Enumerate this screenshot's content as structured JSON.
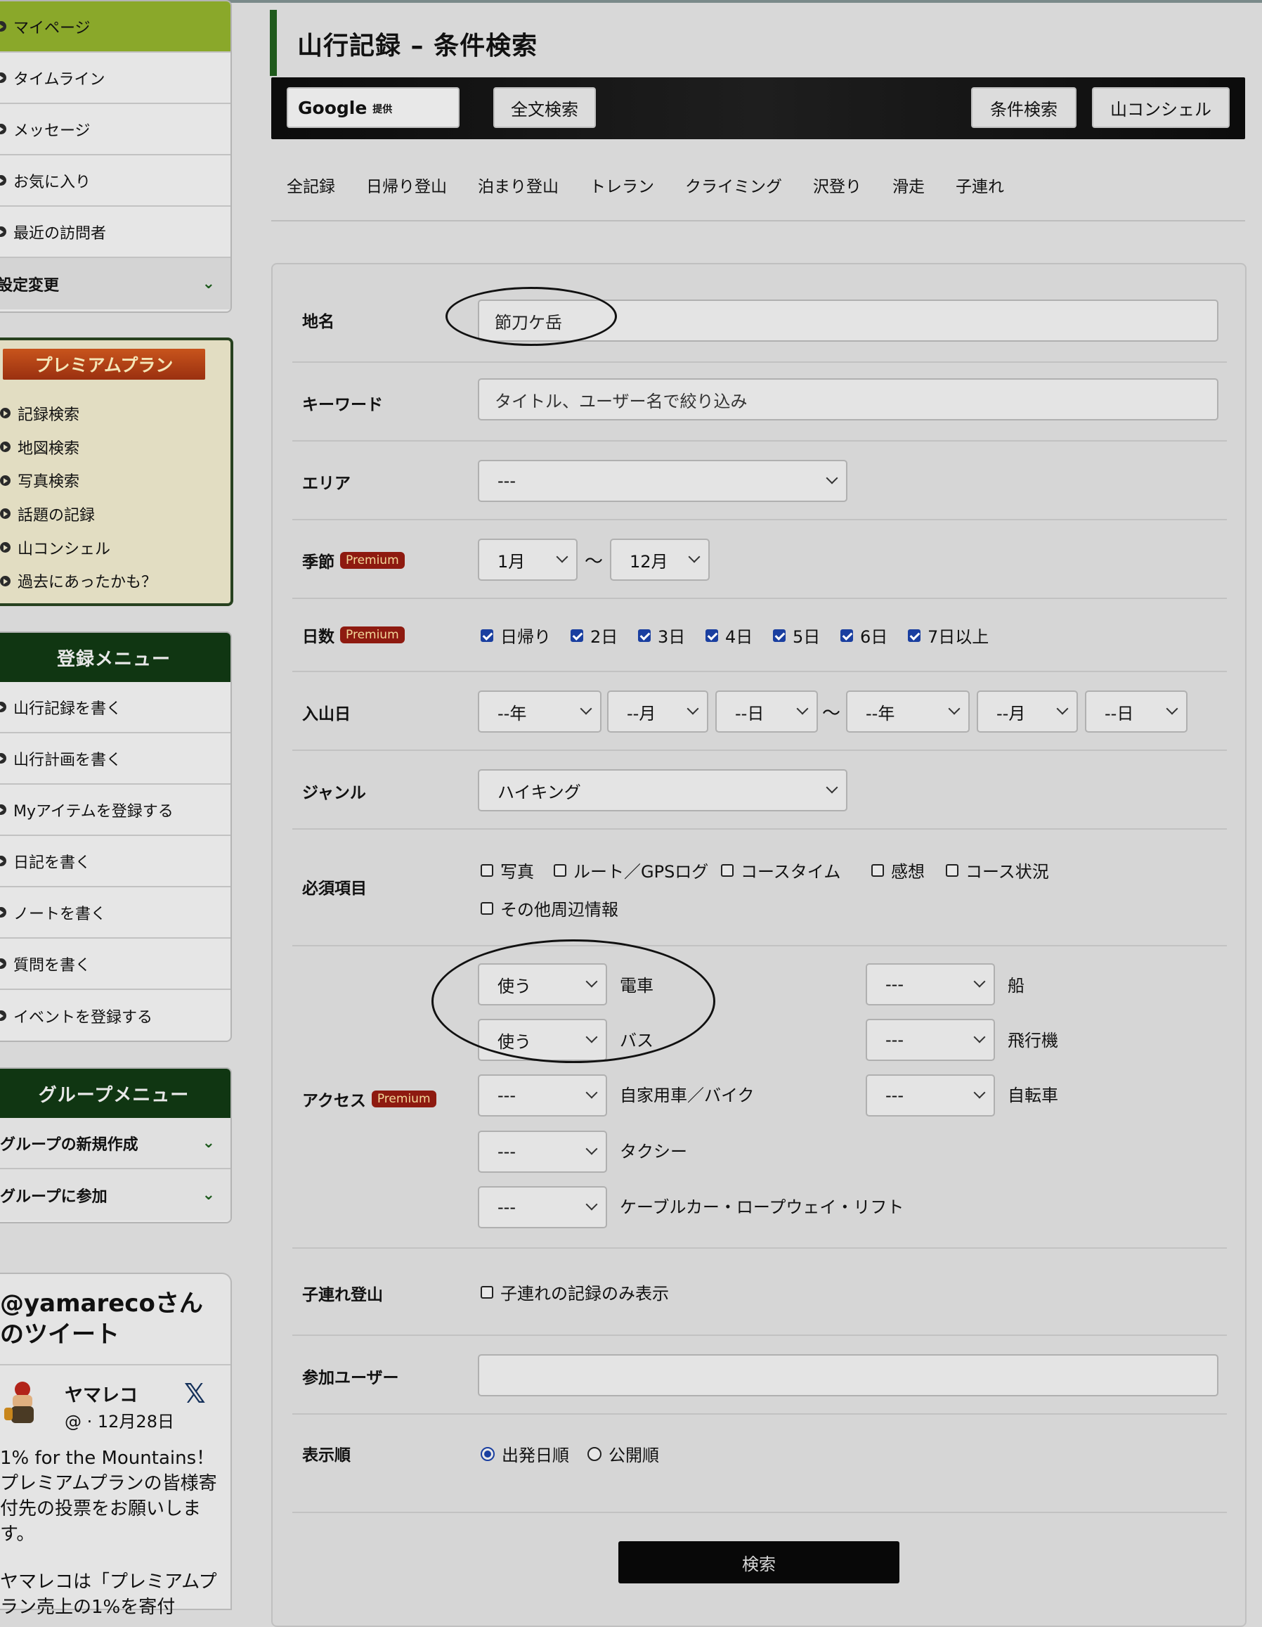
{
  "sidebar": {
    "main_menu": [
      {
        "label": "マイページ",
        "active": true
      },
      {
        "label": "タイムライン"
      },
      {
        "label": "メッセージ"
      },
      {
        "label": "お気に入り"
      },
      {
        "label": "最近の訪問者"
      }
    ],
    "settings_label": "設定変更",
    "premium": {
      "title": "プレミアムプラン",
      "items": [
        "記録検索",
        "地図検索",
        "写真検索",
        "話題の記録",
        "山コンシェル",
        "過去にあったかも？"
      ]
    },
    "register": {
      "title": "登録メニュー",
      "items": [
        "山行記録を書く",
        "山行計画を書く",
        "Myアイテムを登録する",
        "日記を書く",
        "ノートを書く",
        "質問を書く",
        "イベントを登録する"
      ]
    },
    "group": {
      "title": "グループメニュー",
      "items": [
        "グループの新規作成",
        "グループに参加"
      ]
    },
    "tweets": {
      "title": "@yamarecoさんのツイート",
      "name": "ヤマレコ",
      "handle": "@ · 12月28日",
      "text": "1% for the Mountains！プレミアムプランの皆様寄付先の投票をお願いします。",
      "text2": "ヤマレコは「プレミアムプラン売上の1%を寄付"
    }
  },
  "page": {
    "title": "山行記録 – 条件検索",
    "google_label": "Google",
    "google_sub": "提供",
    "fulltext_button": "全文検索",
    "condition_button": "条件検索",
    "concierge_button": "山コンシェル",
    "tabs": [
      "全記録",
      "日帰り登山",
      "泊まり登山",
      "トレラン",
      "クライミング",
      "沢登り",
      "滑走",
      "子連れ"
    ]
  },
  "form": {
    "premium_badge": "Premium",
    "place": {
      "label": "地名",
      "value": "節刀ケ岳"
    },
    "keyword": {
      "label": "キーワード",
      "placeholder": "タイトル、ユーザー名で絞り込み"
    },
    "area": {
      "label": "エリア",
      "value": "---"
    },
    "season": {
      "label": "季節",
      "from": "1月",
      "to": "12月",
      "tilde": "〜"
    },
    "days": {
      "label": "日数",
      "options": [
        "日帰り",
        "2日",
        "3日",
        "4日",
        "5日",
        "6日",
        "7日以上"
      ]
    },
    "date": {
      "label": "入山日",
      "year": "--年",
      "month": "--月",
      "day": "--日",
      "tilde": "〜"
    },
    "genre": {
      "label": "ジャンル",
      "value": "ハイキング"
    },
    "required": {
      "label": "必須項目",
      "options": [
        "写真",
        "ルート／GPSログ",
        "コースタイム",
        "感想",
        "コース状況",
        "その他周辺情報"
      ]
    },
    "access": {
      "label": "アクセス",
      "left": [
        {
          "value": "使う",
          "name": "電車"
        },
        {
          "value": "使う",
          "name": "バス"
        },
        {
          "value": "---",
          "name": "自家用車／バイク"
        },
        {
          "value": "---",
          "name": "タクシー"
        },
        {
          "value": "---",
          "name": "ケーブルカー・ロープウェイ・リフト"
        }
      ],
      "right": [
        {
          "value": "---",
          "name": "船"
        },
        {
          "value": "---",
          "name": "飛行機"
        },
        {
          "value": "---",
          "name": "自転車"
        }
      ]
    },
    "kids": {
      "label": "子連れ登山",
      "option": "子連れの記録のみ表示"
    },
    "users": {
      "label": "参加ユーザー",
      "value": ""
    },
    "order": {
      "label": "表示順",
      "options": [
        "出発日順",
        "公開順"
      ],
      "selected": "出発日順"
    },
    "submit": "検索"
  }
}
